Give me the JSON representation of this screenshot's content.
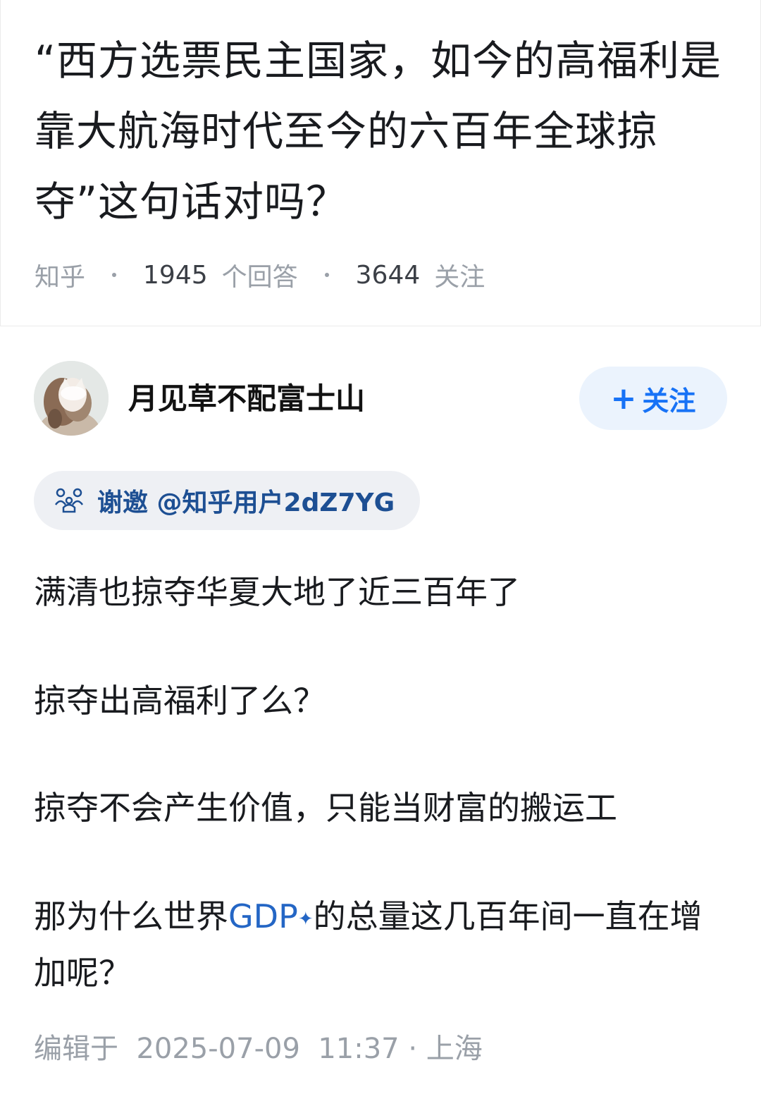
{
  "question": {
    "title": "“西方选票民主国家，如今的高福利是靠大航海时代至今的六百年全球掠夺”这句话对吗？",
    "source": "知乎",
    "answer_count": "1945",
    "answer_unit": "个回答",
    "follower_count": "3644",
    "follower_unit": "关注"
  },
  "author": {
    "name": "月见草不配富士山",
    "avatar_icon": "avatar-image",
    "follow_label": "关注",
    "follow_plus": "+"
  },
  "invite": {
    "icon": "invite-thanks-icon",
    "label": "谢邀 @知乎用户2dZ7YG"
  },
  "answer": {
    "paragraphs": [
      "满清也掠夺华夏大地了近三百年了",
      "掠夺出高福利了么？",
      "掠夺不会产生价值，只能当财富的搬运工"
    ],
    "p4_before": "那为什么世界",
    "p4_link": "GDP",
    "p4_after": "的总量这几百年间一直在增加呢？"
  },
  "edit": {
    "label": "编辑于",
    "date": "2025-07-09",
    "time": "11:37",
    "location": "上海"
  },
  "colors": {
    "accent": "#1772f6",
    "link": "#2466c5",
    "chip_text": "#1d4f93",
    "muted": "#9aa0a8"
  }
}
